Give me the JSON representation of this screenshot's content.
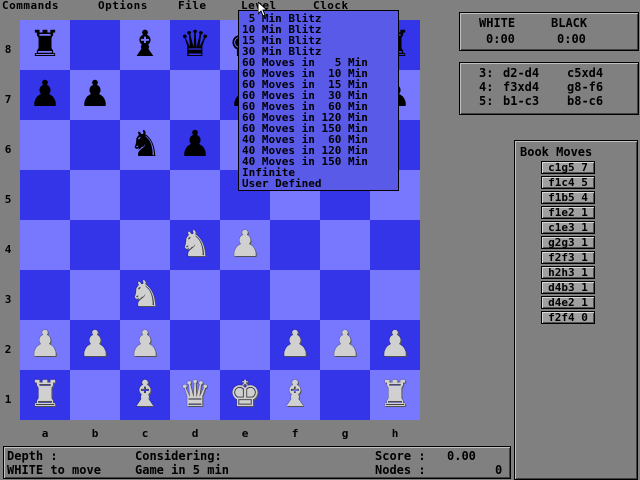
{
  "menu": {
    "commands": "Commands",
    "options": "Options",
    "file": "File",
    "level": "Level",
    "clock": "Clock"
  },
  "colors": {
    "light_square": "#7878ff",
    "dark_square": "#3434e8",
    "background": "#808080",
    "dropdown_bg": "#5a5ae8"
  },
  "board": {
    "files": [
      "a",
      "b",
      "c",
      "d",
      "e",
      "f",
      "g",
      "h"
    ],
    "ranks": [
      "8",
      "7",
      "6",
      "5",
      "4",
      "3",
      "2",
      "1"
    ],
    "pieces": [
      {
        "square": "a8",
        "piece": "rook",
        "color": "black",
        "glyph": "♜"
      },
      {
        "square": "c8",
        "piece": "bishop",
        "color": "black",
        "glyph": "♝"
      },
      {
        "square": "d8",
        "piece": "queen",
        "color": "black",
        "glyph": "♛"
      },
      {
        "square": "e8",
        "piece": "king",
        "color": "black",
        "glyph": "♚"
      },
      {
        "square": "h8",
        "piece": "rook",
        "color": "black",
        "glyph": "♜"
      },
      {
        "square": "a7",
        "piece": "pawn",
        "color": "black",
        "glyph": "♟"
      },
      {
        "square": "b7",
        "piece": "pawn",
        "color": "black",
        "glyph": "♟"
      },
      {
        "square": "e7",
        "piece": "pawn",
        "color": "black",
        "glyph": "♟"
      },
      {
        "square": "h7",
        "piece": "pawn",
        "color": "black",
        "glyph": "♟"
      },
      {
        "square": "c6",
        "piece": "knight",
        "color": "black",
        "glyph": "♞"
      },
      {
        "square": "d6",
        "piece": "pawn",
        "color": "black",
        "glyph": "♟"
      },
      {
        "square": "d4",
        "piece": "knight",
        "color": "white",
        "glyph": "♞"
      },
      {
        "square": "e4",
        "piece": "pawn",
        "color": "white",
        "glyph": "♟"
      },
      {
        "square": "c3",
        "piece": "knight",
        "color": "white",
        "glyph": "♞"
      },
      {
        "square": "a2",
        "piece": "pawn",
        "color": "white",
        "glyph": "♟"
      },
      {
        "square": "b2",
        "piece": "pawn",
        "color": "white",
        "glyph": "♟"
      },
      {
        "square": "c2",
        "piece": "pawn",
        "color": "white",
        "glyph": "♟"
      },
      {
        "square": "f2",
        "piece": "pawn",
        "color": "white",
        "glyph": "♟"
      },
      {
        "square": "g2",
        "piece": "pawn",
        "color": "white",
        "glyph": "♟"
      },
      {
        "square": "h2",
        "piece": "pawn",
        "color": "white",
        "glyph": "♟"
      },
      {
        "square": "a1",
        "piece": "rook",
        "color": "white",
        "glyph": "♜"
      },
      {
        "square": "c1",
        "piece": "bishop",
        "color": "white",
        "glyph": "♝"
      },
      {
        "square": "d1",
        "piece": "queen",
        "color": "white",
        "glyph": "♛"
      },
      {
        "square": "e1",
        "piece": "king",
        "color": "white",
        "glyph": "♚"
      },
      {
        "square": "f1",
        "piece": "bishop",
        "color": "white",
        "glyph": "♝"
      },
      {
        "square": "h1",
        "piece": "rook",
        "color": "white",
        "glyph": "♜"
      }
    ]
  },
  "level_menu": {
    "items": [
      " 5 Min Blitz",
      "10 Min Blitz",
      "15 Min Blitz",
      "30 Min Blitz",
      "60 Moves in   5 Min",
      "60 Moves in  10 Min",
      "60 Moves in  15 Min",
      "60 Moves in  30 Min",
      "60 Moves in  60 Min",
      "60 Moves in 120 Min",
      "60 Moves in 150 Min",
      "40 Moves in  60 Min",
      "40 Moves in 120 Min",
      "40 Moves in 150 Min",
      "Infinite",
      "User Defined"
    ]
  },
  "clock": {
    "white_label": "WHITE",
    "black_label": "BLACK",
    "white_time": "0:00",
    "black_time": "0:00"
  },
  "moves": [
    {
      "num": "3:",
      "white": "d2-d4",
      "black": "c5xd4"
    },
    {
      "num": "4:",
      "white": "f3xd4",
      "black": "g8-f6"
    },
    {
      "num": "5:",
      "white": "b1-c3",
      "black": "b8-c6"
    }
  ],
  "book": {
    "title": "Book Moves",
    "moves": [
      "c1g5 7",
      "f1c4 5",
      "f1b5 4",
      "f1e2 1",
      "c1e3 1",
      "g2g3 1",
      "f2f3 1",
      "h2h3 1",
      "d4b3 1",
      "d4e2 1",
      "f2f4 0"
    ]
  },
  "status": {
    "depth_label": "Depth :",
    "considering_label": "Considering:",
    "score_label": "Score :",
    "score_value": "0.00",
    "to_move": "WHITE to move",
    "game_type": "Game in 5 min",
    "nodes_label": "Nodes :",
    "nodes_value": "0"
  }
}
